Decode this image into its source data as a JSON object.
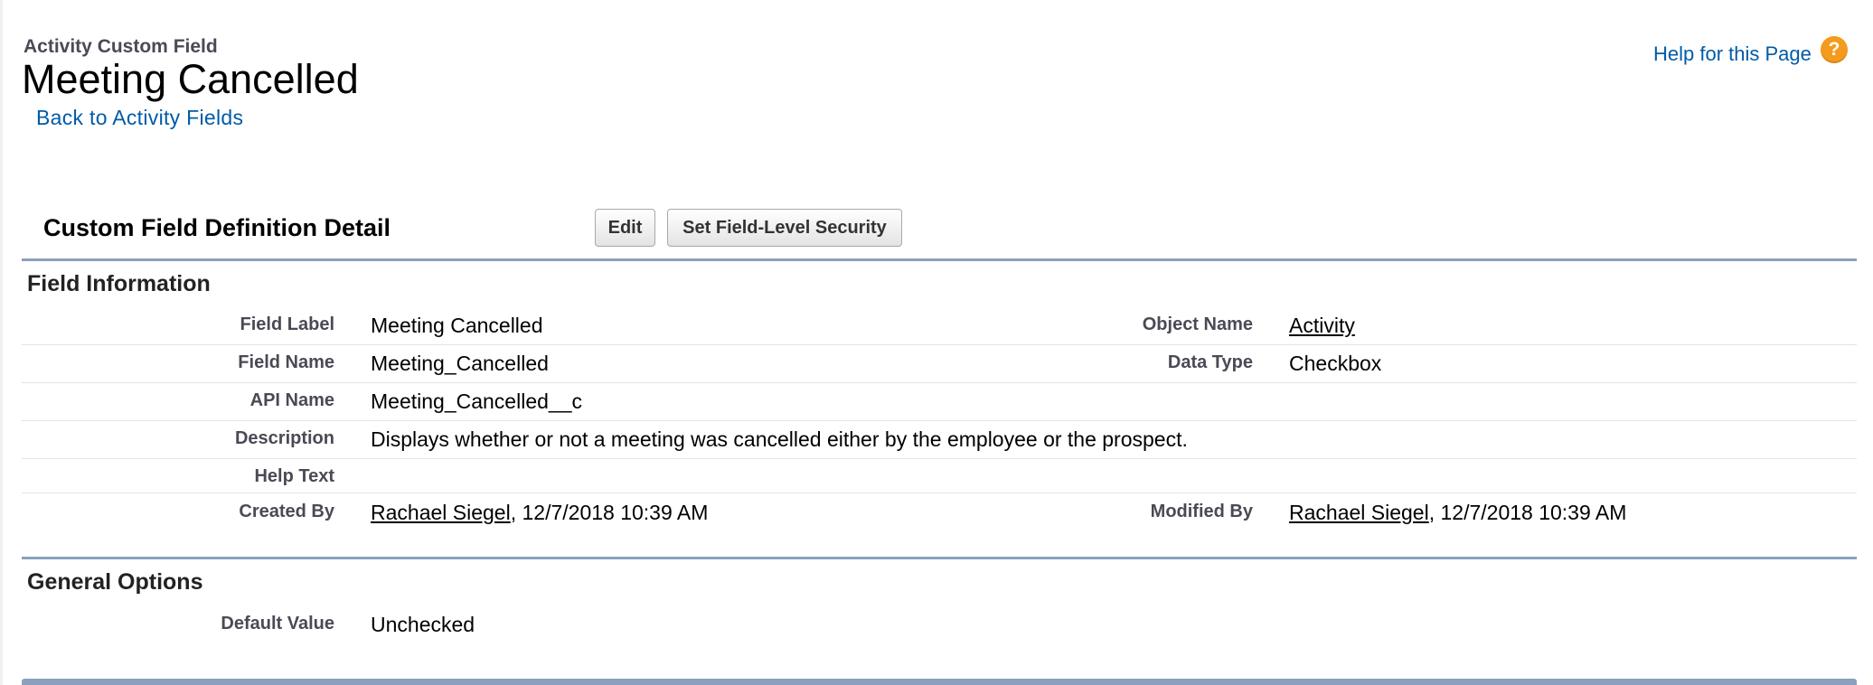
{
  "header": {
    "page_type": "Activity Custom Field",
    "title": "Meeting Cancelled",
    "back_link": "Back to Activity Fields",
    "help_link": "Help for this Page",
    "help_icon": "question-mark-icon",
    "help_icon_glyph": "?"
  },
  "detail": {
    "title": "Custom Field Definition Detail",
    "buttons": {
      "edit": "Edit",
      "field_level_security": "Set Field-Level Security"
    }
  },
  "field_information": {
    "header": "Field Information",
    "field_label": {
      "label": "Field Label",
      "value": "Meeting Cancelled"
    },
    "object_name": {
      "label": "Object Name",
      "value": "Activity"
    },
    "field_name": {
      "label": "Field Name",
      "value": "Meeting_Cancelled"
    },
    "data_type": {
      "label": "Data Type",
      "value": "Checkbox"
    },
    "api_name": {
      "label": "API Name",
      "value": "Meeting_Cancelled__c"
    },
    "description": {
      "label": "Description",
      "value": "Displays whether or not a meeting was cancelled either by the employee or the prospect."
    },
    "help_text": {
      "label": "Help Text",
      "value": ""
    },
    "created_by": {
      "label": "Created By",
      "user": "Rachael Siegel",
      "date": ", 12/7/2018 10:39 AM"
    },
    "modified_by": {
      "label": "Modified By",
      "user": "Rachael Siegel",
      "date": ", 12/7/2018 10:39 AM"
    }
  },
  "general_options": {
    "header": "General Options",
    "default_value": {
      "label": "Default Value",
      "value": "Unchecked"
    }
  },
  "colors": {
    "link": "#015ba7",
    "section_bar": "#8aa0bd",
    "help_icon": "#f49b1d",
    "label": "#4a4a56"
  }
}
